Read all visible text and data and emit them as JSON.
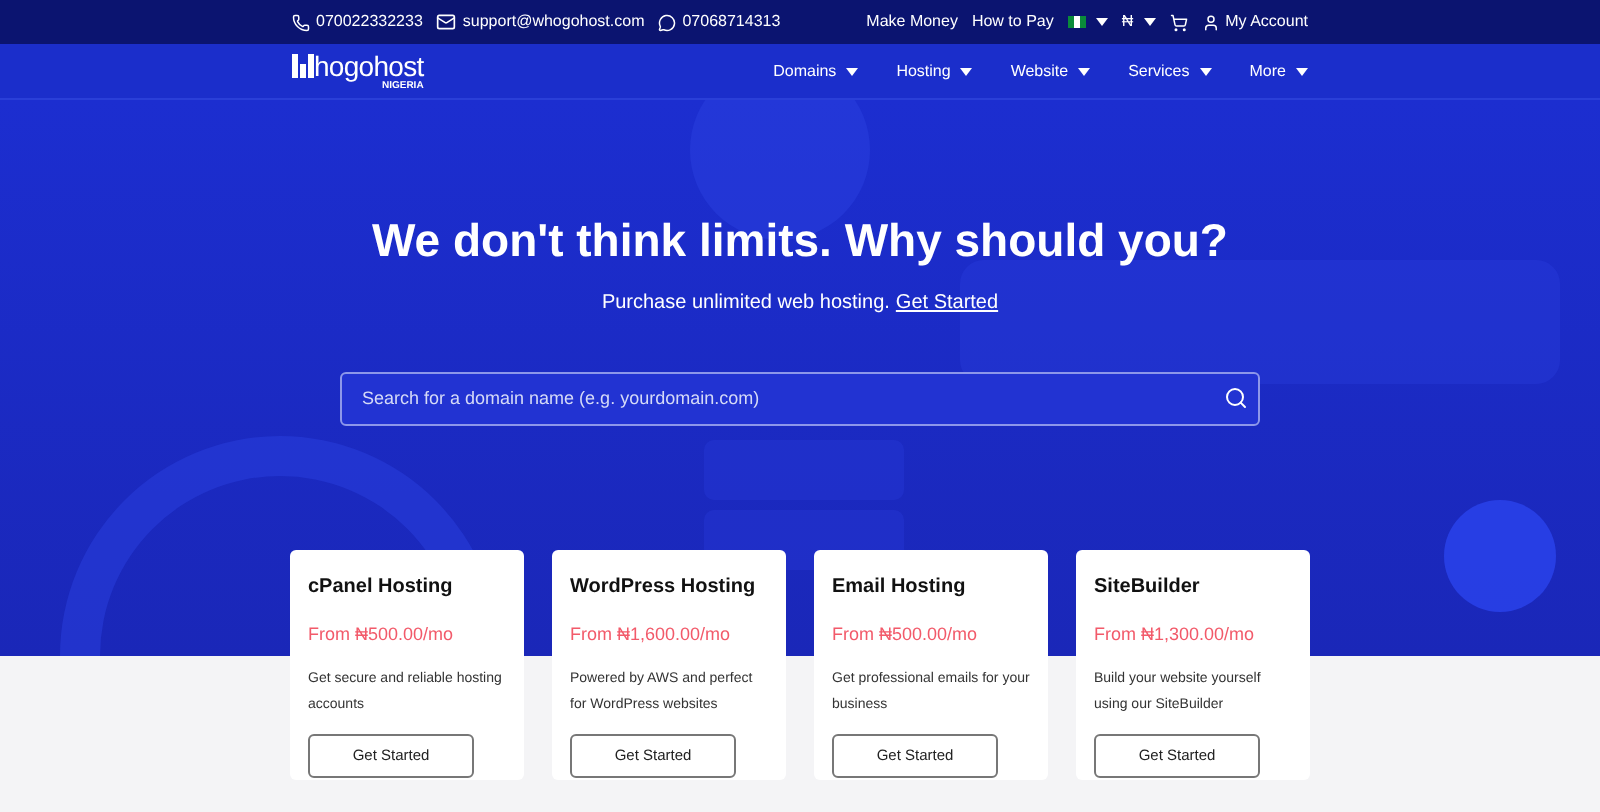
{
  "topbar": {
    "contacts": [
      {
        "kind": "phone",
        "text": "070022332233"
      },
      {
        "kind": "email",
        "text": "support@whogohost.com"
      },
      {
        "kind": "whatsapp",
        "text": "07068714313"
      }
    ],
    "links": [
      "Make Money",
      "How to Pay"
    ],
    "currency": "₦",
    "account": "My Account"
  },
  "navbar": {
    "logo": "hogohost",
    "logo_sub": "NIGERIA",
    "items": [
      "Domains",
      "Hosting",
      "Website",
      "Services",
      "More"
    ]
  },
  "hero": {
    "title": "We don't think limits. Why should you?",
    "subtitle": "Purchase unlimited web hosting.",
    "subtitle_link": "Get Started",
    "search": {
      "placeholder": "Search for a domain name (e.g. yourdomain.com)"
    }
  },
  "cards": [
    {
      "title": "cPanel Hosting",
      "price": "From ₦500.00/mo",
      "description": "Get secure and reliable hosting accounts",
      "button": "Get Started"
    },
    {
      "title": "WordPress Hosting",
      "price": "From ₦1,600.00/mo",
      "description": "Powered by AWS and perfect for WordPress websites",
      "button": "Get Started"
    },
    {
      "title": "Email Hosting",
      "price": "From ₦500.00/mo",
      "description": "Get professional emails for your business",
      "button": "Get Started"
    },
    {
      "title": "SiteBuilder",
      "price": "From ₦1,300.00/mo",
      "description": "Build your website yourself using our SiteBuilder",
      "button": "Get Started"
    }
  ]
}
